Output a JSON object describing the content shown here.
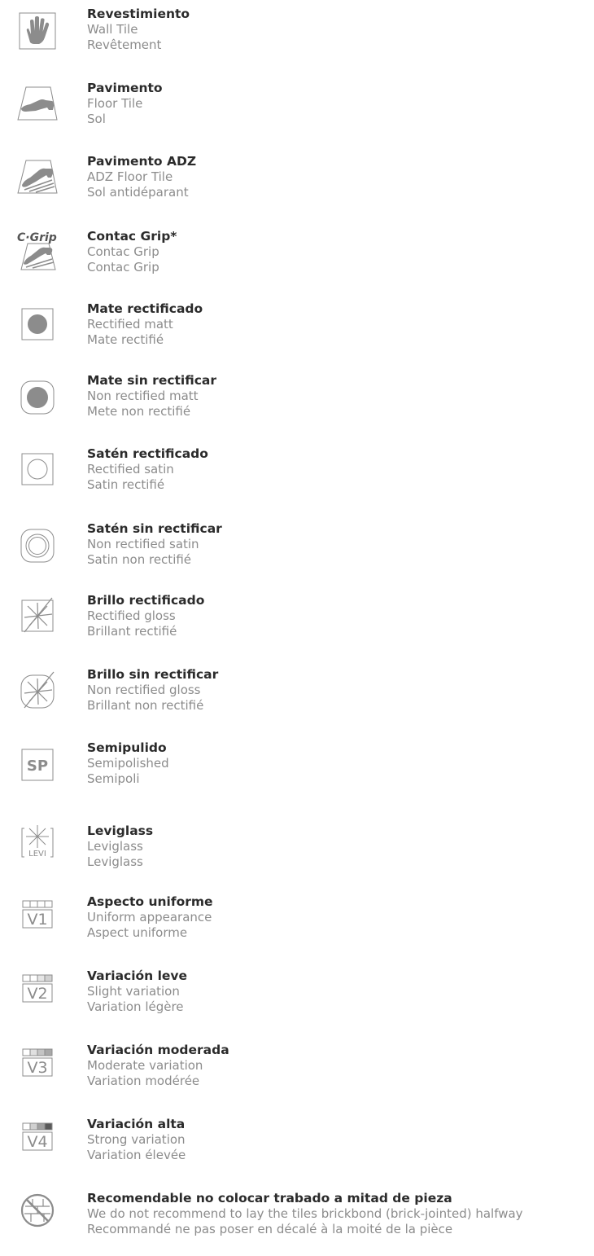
{
  "items": [
    {
      "icon": "hand-icon",
      "title": "Revestimiento",
      "en": "Wall Tile",
      "fr": "Revêtement"
    },
    {
      "icon": "floor-shoe-icon",
      "title": "Pavimento",
      "en": "Floor Tile",
      "fr": "Sol"
    },
    {
      "icon": "adz-shoe-icon",
      "title": "Pavimento ADZ",
      "en": "ADZ Floor Tile",
      "fr": "Sol antidéparant"
    },
    {
      "icon": "cgrip-icon",
      "icon_text": "C·Grip",
      "title": "Contac Grip*",
      "en": "Contac Grip",
      "fr": "Contac Grip"
    },
    {
      "icon": "matt-rectified-icon",
      "title": "Mate rectificado",
      "en": "Rectified matt",
      "fr": "Mate rectifié"
    },
    {
      "icon": "matt-non-rectified-icon",
      "title": "Mate sin rectificar",
      "en": "Non rectified matt",
      "fr": "Mete non rectifié"
    },
    {
      "icon": "satin-rectified-icon",
      "title": "Satén rectificado",
      "en": "Rectified satin",
      "fr": "Satin rectifié"
    },
    {
      "icon": "satin-non-rectified-icon",
      "title": "Satén sin rectificar",
      "en": "Non rectified satin",
      "fr": "Satin non rectifié"
    },
    {
      "icon": "gloss-rectified-icon",
      "title": "Brillo rectificado",
      "en": "Rectified gloss",
      "fr": "Brillant rectifié"
    },
    {
      "icon": "gloss-non-rectified-icon",
      "title": "Brillo sin rectificar",
      "en": "Non rectified gloss",
      "fr": "Brillant non rectifié"
    },
    {
      "icon": "semipolished-icon",
      "icon_text": "SP",
      "title": "Semipulido",
      "en": "Semipolished",
      "fr": "Semipoli"
    },
    {
      "icon": "leviglass-icon",
      "icon_text": "LEVI",
      "title": "Leviglass",
      "en": "Leviglass",
      "fr": "Leviglass"
    },
    {
      "icon": "v1-icon",
      "icon_text": "V1",
      "title": "Aspecto uniforme",
      "en": "Uniform appearance",
      "fr": "Aspect uniforme"
    },
    {
      "icon": "v2-icon",
      "icon_text": "V2",
      "title": "Variación leve",
      "en": "Slight variation",
      "fr": "Variation légère"
    },
    {
      "icon": "v3-icon",
      "icon_text": "V3",
      "title": "Variación moderada",
      "en": "Moderate variation",
      "fr": "Variation modérée"
    },
    {
      "icon": "v4-icon",
      "icon_text": "V4",
      "title": "Variación alta",
      "en": "Strong variation",
      "fr": "Variation élevée"
    },
    {
      "icon": "no-brickbond-icon",
      "title": "Recomendable no colocar trabado a mitad de pieza",
      "en": "We do not recommend to lay the tiles brickbond (brick-jointed) halfway",
      "fr": "Recommandé ne pas poser  en décalé à la moité de la pièce"
    }
  ],
  "colors": {
    "icon_gray": "#8c8c8c",
    "title": "#2b2b2b",
    "subtitle": "#8c8c8c"
  }
}
